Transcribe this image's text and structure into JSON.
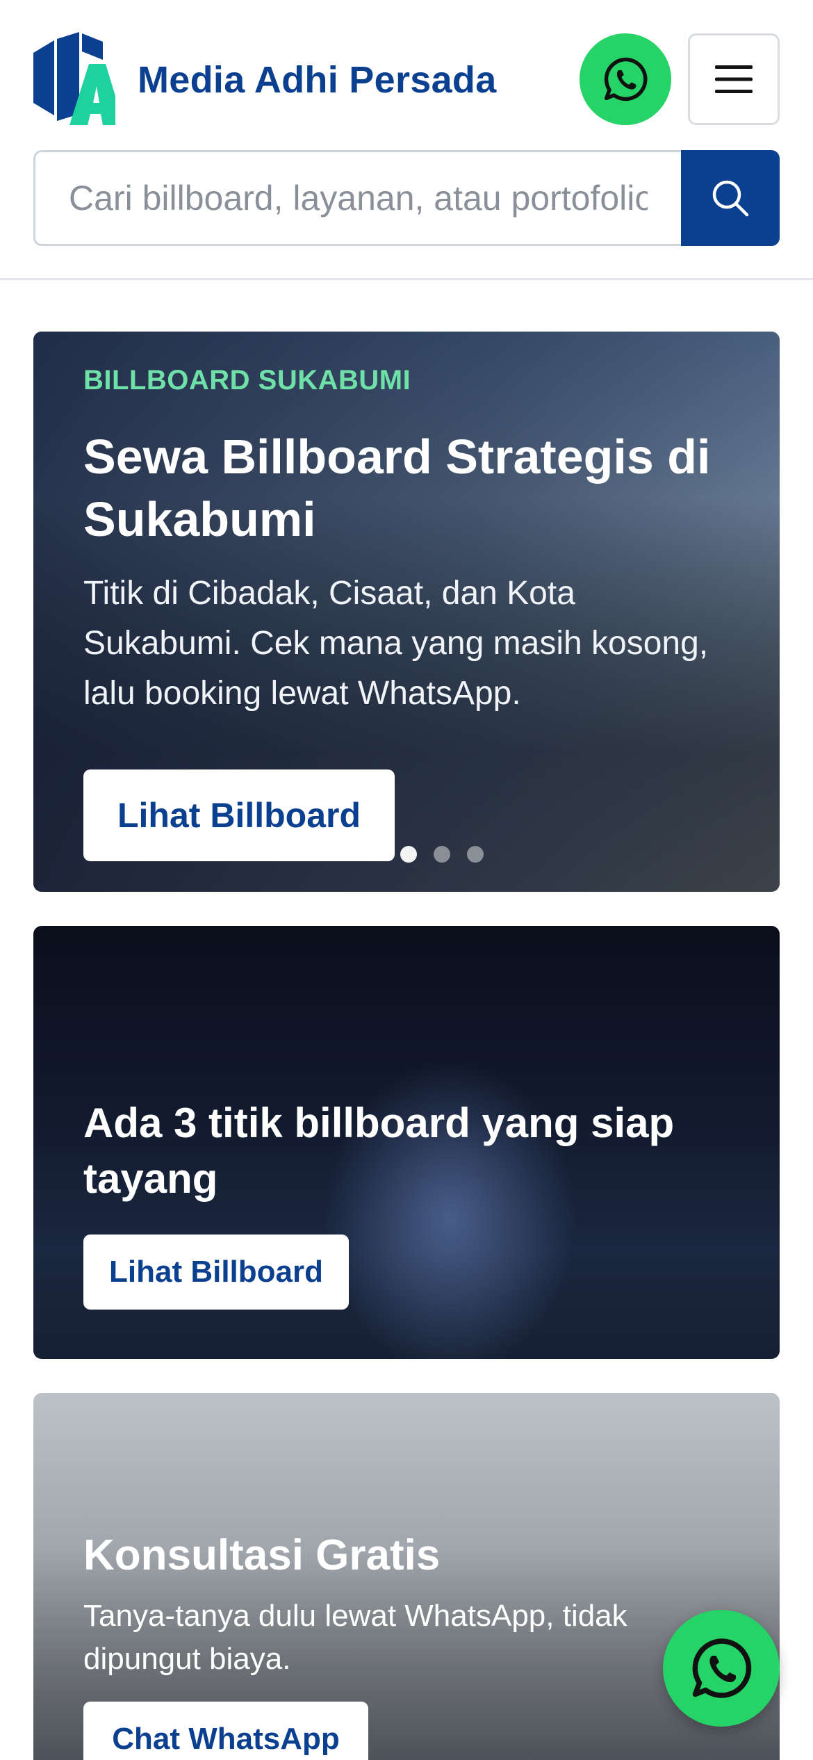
{
  "header": {
    "brand": "Media Adhi Persada",
    "whatsapp_icon": "whatsapp-icon",
    "menu_icon": "hamburger-menu-icon"
  },
  "search": {
    "placeholder": "Cari billboard, layanan, atau portofolio",
    "value": "",
    "icon": "search-icon"
  },
  "hero": {
    "eyebrow": "BILLBOARD SUKABUMI",
    "title": "Sewa Billboard Strategis di Sukabumi",
    "description": "Titik di Cibadak, Cisaat, dan Kota Sukabumi. Cek mana yang masih kosong, lalu booking lewat WhatsApp.",
    "button": "Lihat Billboard",
    "slides_total": 3,
    "active_slide": 1
  },
  "promo_billboard": {
    "title": "Ada 3 titik billboard yang siap tayang",
    "button": "Lihat Billboard"
  },
  "consultation": {
    "title": "Konsultasi Gratis",
    "description": "Tanya-tanya dulu lewat WhatsApp, tidak dipungut biaya.",
    "button": "Chat WhatsApp"
  },
  "floating_button": {
    "icon": "whatsapp-icon"
  },
  "colors": {
    "brand_blue": "#0b3f8f",
    "whatsapp_green": "#25d366",
    "accent_green": "#6fe0a8"
  }
}
